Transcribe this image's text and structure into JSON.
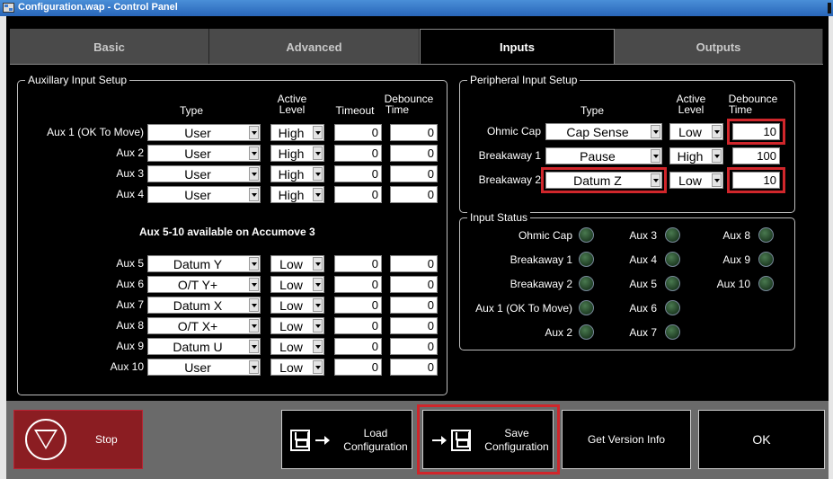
{
  "window": {
    "title": "Configuration.wap - Control Panel"
  },
  "tabs": [
    "Basic",
    "Advanced",
    "Inputs",
    "Outputs"
  ],
  "active_tab": "Inputs",
  "aux_group": {
    "legend": "Auxillary Input Setup",
    "headers": {
      "type": "Type",
      "active_level_1": "Active",
      "active_level_2": "Level",
      "timeout": "Timeout",
      "debounce_1": "Debounce",
      "debounce_2": "Time"
    },
    "rows": [
      {
        "label": "Aux 1 (OK To Move)",
        "type": "User",
        "level": "High",
        "timeout": "0",
        "debounce": "0"
      },
      {
        "label": "Aux 2",
        "type": "User",
        "level": "High",
        "timeout": "0",
        "debounce": "0"
      },
      {
        "label": "Aux 3",
        "type": "User",
        "level": "High",
        "timeout": "0",
        "debounce": "0"
      },
      {
        "label": "Aux 4",
        "type": "User",
        "level": "High",
        "timeout": "0",
        "debounce": "0"
      },
      {
        "label": "Aux 5",
        "type": "Datum Y",
        "level": "Low",
        "timeout": "0",
        "debounce": "0"
      },
      {
        "label": "Aux 6",
        "type": "O/T Y+",
        "level": "Low",
        "timeout": "0",
        "debounce": "0"
      },
      {
        "label": "Aux 7",
        "type": "Datum X",
        "level": "Low",
        "timeout": "0",
        "debounce": "0"
      },
      {
        "label": "Aux 8",
        "type": "O/T X+",
        "level": "Low",
        "timeout": "0",
        "debounce": "0"
      },
      {
        "label": "Aux 9",
        "type": "Datum U",
        "level": "Low",
        "timeout": "0",
        "debounce": "0"
      },
      {
        "label": "Aux 10",
        "type": "User",
        "level": "Low",
        "timeout": "0",
        "debounce": "0"
      }
    ],
    "note": "Aux 5-10 available on Accumove 3"
  },
  "peripheral_group": {
    "legend": "Peripheral Input Setup",
    "headers": {
      "type": "Type",
      "active_level_1": "Active",
      "active_level_2": "Level",
      "debounce_1": "Debounce",
      "debounce_2": "Time"
    },
    "rows": [
      {
        "label": "Ohmic Cap",
        "type": "Cap Sense",
        "level": "Low",
        "debounce": "10"
      },
      {
        "label": "Breakaway 1",
        "type": "Pause",
        "level": "High",
        "debounce": "100"
      },
      {
        "label": "Breakaway 2",
        "type": "Datum Z",
        "level": "Low",
        "debounce": "10"
      }
    ]
  },
  "status_group": {
    "legend": "Input Status",
    "col1": [
      "Ohmic Cap",
      "Breakaway 1",
      "Breakaway 2",
      "Aux 1 (OK To Move)",
      "Aux 2"
    ],
    "col2": [
      "Aux 3",
      "Aux 4",
      "Aux 5",
      "Aux 6",
      "Aux 7"
    ],
    "col3": [
      "Aux 8",
      "Aux 9",
      "Aux 10"
    ]
  },
  "bottom": {
    "stop": "Stop",
    "load_1": "Load",
    "load_2": "Configuration",
    "save_1": "Save",
    "save_2": "Configuration",
    "version": "Get Version Info",
    "ok": "OK"
  },
  "colors": {
    "highlight": "#d0262b",
    "led": "#2f5a36",
    "stop": "#8b1d22"
  }
}
